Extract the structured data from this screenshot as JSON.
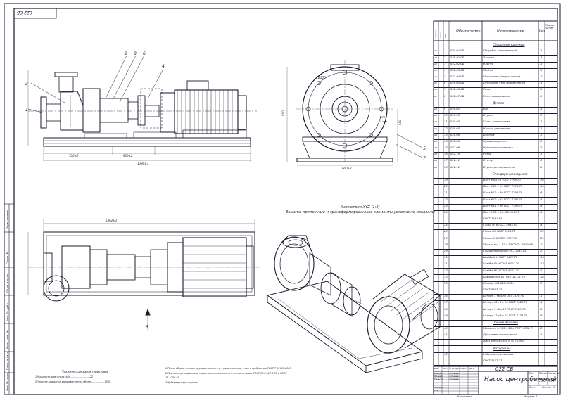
{
  "drawing": {
    "code": "022 СБ",
    "title_code": "022 СБ",
    "title_name": "Насос центробежный",
    "litera": "У",
    "mass": "150",
    "scale": "1:4",
    "sheet_label": "Лист",
    "sheets_label": "Листов",
    "sheets": "1",
    "copied": "Копировал",
    "format": "Формат   A1"
  },
  "title_block_labels": [
    "Изм.",
    "Лист",
    "№ докум.",
    "Подп.",
    "Дата",
    "Разраб.",
    "Провер.",
    "Т.контр.",
    "Н.контр.",
    "Утв."
  ],
  "title_block_people": [
    "Ломачев",
    "Ломачев",
    "Ломачев"
  ],
  "title_block_heads": [
    "Лит.",
    "Масса",
    "Масштаб"
  ],
  "isometry": {
    "title": "Изометрия XYZ (1:5)",
    "note": "Защита, крепежные и трансформированные элементы условно не показаны"
  },
  "specification": {
    "headers": [
      "Формат",
      "Зона",
      "Поз.",
      "Обозначение",
      "Наименование",
      "Кол.",
      "Приме-чание"
    ],
    "rows": [
      {
        "type": "section",
        "name": "Сборочные единицы"
      },
      {
        "fmt": "A1",
        "pos": "1",
        "code": "020-01 СБ",
        "name": "Патрубок всасывающий",
        "qty": "1"
      },
      {
        "fmt": "A3",
        "pos": "2",
        "code": "020-01 СБ",
        "name": "Защита",
        "qty": "1"
      },
      {
        "fmt": "A1",
        "pos": "3",
        "code": "022-02 СБ",
        "name": "Корпус",
        "qty": "1"
      },
      {
        "fmt": "A1",
        "pos": "4",
        "code": "022-03 СБ",
        "name": "Муфта",
        "qty": "1"
      },
      {
        "fmt": "A1",
        "pos": "5",
        "code": "022-04 СБ",
        "name": "Основание корпуса насоса",
        "qty": "1"
      },
      {
        "fmt": "A1",
        "pos": "6",
        "code": "020-05 СБ",
        "name": "Основание узла подшипников",
        "qty": "1"
      },
      {
        "fmt": "A1",
        "pos": "7",
        "code": "022-06 СБ",
        "name": "Рама",
        "qty": "1"
      },
      {
        "fmt": "A1",
        "pos": "8",
        "code": "022-07 СБ",
        "name": "Узел подшипников",
        "qty": "1"
      },
      {
        "type": "section",
        "name": "Детали"
      },
      {
        "fmt": "A3",
        "pos": "9",
        "code": "020-02",
        "name": "Вал",
        "qty": "1"
      },
      {
        "fmt": "A4",
        "pos": "10",
        "code": "020-03",
        "name": "Втулка",
        "qty": "1"
      },
      {
        "fmt": "A4",
        "pos": "11",
        "code": "020-03",
        "name": "Гайка колпачковая",
        "qty": "1"
      },
      {
        "fmt": "A4",
        "pos": "12",
        "code": "020-05",
        "name": "Кольцо уплотнения",
        "qty": "1"
      },
      {
        "fmt": "A4",
        "pos": "13",
        "code": "020-06",
        "name": "Шпонка",
        "qty": "1"
      },
      {
        "fmt": "A4",
        "pos": "14",
        "code": "022-08",
        "name": "Крышка корпуса",
        "qty": "1"
      },
      {
        "fmt": "A4",
        "pos": "15",
        "code": "022-09",
        "name": "Крышка подшипника",
        "qty": "2"
      },
      {
        "fmt": "A4",
        "pos": "16",
        "code": "022-10",
        "name": "Ротор",
        "qty": "1"
      },
      {
        "fmt": "A4",
        "pos": "17",
        "code": "022-11",
        "name": "Статор",
        "qty": "1"
      },
      {
        "fmt": "A4",
        "pos": "18",
        "code": "022-12",
        "name": "Втулка дистанционная",
        "qty": "2"
      },
      {
        "type": "section",
        "name": "Стандартные изделия"
      },
      {
        "pos": "19",
        "code": "",
        "name": "Болт М6 х 25 ГОСТ 7798-70",
        "qty": "16"
      },
      {
        "pos": "20",
        "code": "",
        "name": "Болт М10 х 16 ГОСТ 7798-70",
        "qty": "16"
      },
      {
        "pos": "21",
        "code": "",
        "name": "Болт М10 х 30 ГОСТ 7798-70",
        "qty": "8"
      },
      {
        "pos": "22",
        "code": "",
        "name": "Болт М10 х 35 ГОСТ 7798-70",
        "qty": "4"
      },
      {
        "pos": "23",
        "code": "",
        "name": "Болт М16 х 80 ГОСТ 7798-70",
        "qty": "4"
      },
      {
        "pos": "24",
        "code": "",
        "name": "Винт М10 х 16-12Х18Н10Т",
        "qty": "4"
      },
      {
        "pos": "",
        "code": "",
        "name": "ГОСТ 1491-80",
        "qty": ""
      },
      {
        "pos": "25",
        "code": "",
        "name": "Гайка М16 ГОСТ 5915-70",
        "qty": "4"
      },
      {
        "pos": "26",
        "code": "",
        "name": "Гайка М6 ГОСТ 5915-70",
        "qty": "12"
      },
      {
        "pos": "27",
        "code": "",
        "name": "Гайка М10 ГОСТ 5927-70",
        "qty": "24"
      },
      {
        "pos": "28",
        "code": "",
        "name": "Прокладка 1-63 х 50 ГОСТ 15180-86",
        "qty": "1"
      },
      {
        "pos": "29",
        "code": "",
        "name": "Подшипник 6208 ГОСТ 5242-81",
        "qty": "2"
      },
      {
        "pos": "30",
        "code": "",
        "name": "Шайба 8 Н ГОСТ 6402-70",
        "qty": "16"
      },
      {
        "pos": "31",
        "code": "",
        "name": "Шайба 10 Н ГОСТ 6402-70",
        "qty": "12"
      },
      {
        "pos": "32",
        "code": "",
        "name": "Шайба 16 Н ГОСТ 6402-70",
        "qty": "4"
      },
      {
        "pos": "33",
        "code": "",
        "name": "Шайба М6 х 15 ГОСТ 11371-78",
        "qty": "16"
      },
      {
        "pos": "35",
        "code": "",
        "name": "Кольцо 040-045-30-2-4",
        "qty": "1"
      },
      {
        "pos": "",
        "code": "",
        "name": "ГОСТ 9833-73",
        "qty": ""
      },
      {
        "pos": "36",
        "code": "",
        "name": "Штифт 3 т6 х 8 ГОСТ 3128-70",
        "qty": "1"
      },
      {
        "pos": "37",
        "code": "",
        "name": "Штифт 12 т6 х 16 ГОСТ 3128-70",
        "qty": "4"
      },
      {
        "pos": "38",
        "code": "",
        "name": "Штифт 3 т6 х 10 ГОСТ 3128-70",
        "qty": "8"
      },
      {
        "pos": "39",
        "code": "",
        "name": "Штифт 12 т6 х 15 ГОСТ 3128-70",
        "qty": "8"
      },
      {
        "type": "section",
        "name": "Прочие изделия"
      },
      {
        "pos": "40",
        "code": "",
        "name": "Манжета 1.2-52 х 26-4 ГОСТ 8752-79",
        "qty": "2"
      },
      {
        "pos": "41",
        "code": "",
        "name": "Двигатель асинхронный",
        "qty": "1"
      },
      {
        "pos": "",
        "code": "",
        "name": "АИР180М4 УЗ 380 В 50 Гц IP55",
        "qty": ""
      },
      {
        "type": "section",
        "name": "Материалы"
      },
      {
        "pos": "42",
        "code": "",
        "name": "Набивка сальниковая",
        "qty": ""
      },
      {
        "pos": "",
        "code": "",
        "name": "ГОСТ 5152-77",
        "qty": ""
      }
    ]
  },
  "tech": {
    "heading": "Техническая характеристика",
    "lines": [
      "1   Мощность двигателя, кВт..........................22",
      "2   Частота вращения вала двигателя, об/мин.................1500"
    ],
    "notes": [
      "1   После сборки контактирующие элементы, при испытании, участь требования ГОСТ Р 52743-2007",
      "2   При эксплуатации насос с двигателем заземлить в соответствии с ГОСТ 12.2.007.0-75 и ГОСТ",
      "     12.1030-81",
      "3   *) Размеры для справок"
    ]
  },
  "callouts": [
    "1",
    "2",
    "3",
    "4",
    "5",
    "6",
    "7",
    "8"
  ],
  "dimensions": {
    "front_base": "1390±3",
    "front_a": "700±2",
    "front_b": "900±2",
    "front_h": "810",
    "side_w": "600±2",
    "side_h": "580",
    "side_top": "Ø250",
    "plan_len": "1862±3",
    "side_phi": "Ø78",
    "side_bolt": "4 отв."
  },
  "frame_labels": [
    "Инв. № подл.",
    "Подп. и дата",
    "Взам. инв. №",
    "Инв. № дубл.",
    "Подп. и дата",
    "Справ. №",
    "Перв. примен."
  ],
  "section_mark": "А"
}
